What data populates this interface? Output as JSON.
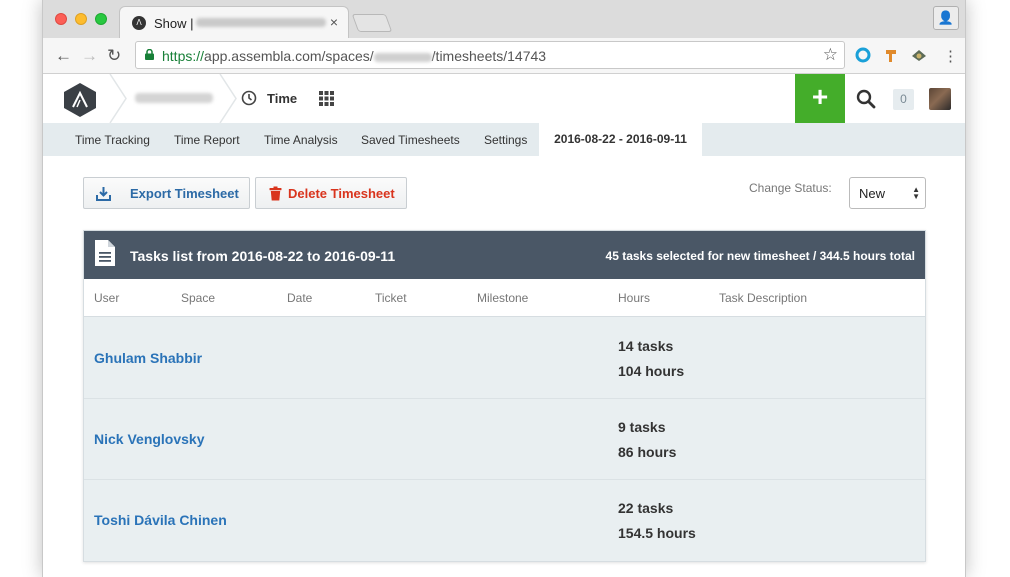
{
  "browser": {
    "tab_title": "Show |",
    "url_scheme": "https://",
    "url_host": "app.assembla.com/spaces/",
    "url_path": "/timesheets/14743"
  },
  "header": {
    "section_label": "Time",
    "notification_count": "0",
    "add_label": "+"
  },
  "subnav": {
    "items": [
      "Time Tracking",
      "Time Report",
      "Time Analysis",
      "Saved Timesheets",
      "Settings"
    ],
    "active": "2016-08-22 - 2016-09-11"
  },
  "actions": {
    "export_label": "Export Timesheet",
    "delete_label": "Delete Timesheet",
    "status_label": "Change Status:",
    "status_value": "New"
  },
  "panel": {
    "title": "Tasks list from 2016-08-22 to 2016-09-11",
    "summary": "45 tasks selected for new timesheet / 344.5 hours total",
    "columns": [
      "User",
      "Space",
      "Date",
      "Ticket",
      "Milestone",
      "Hours",
      "Task Description"
    ],
    "rows": [
      {
        "user": "Ghulam Shabbir",
        "tasks": "14 tasks",
        "hours": "104 hours"
      },
      {
        "user": "Nick Venglovsky",
        "tasks": "9 tasks",
        "hours": "86 hours"
      },
      {
        "user": "Toshi Dávila Chinen",
        "tasks": "22 tasks",
        "hours": "154.5 hours"
      }
    ]
  },
  "colors": {
    "accent_green": "#44ad2a",
    "panel_header": "#4a5766",
    "link_blue": "#2a73b8",
    "delete_red": "#d9341d"
  }
}
